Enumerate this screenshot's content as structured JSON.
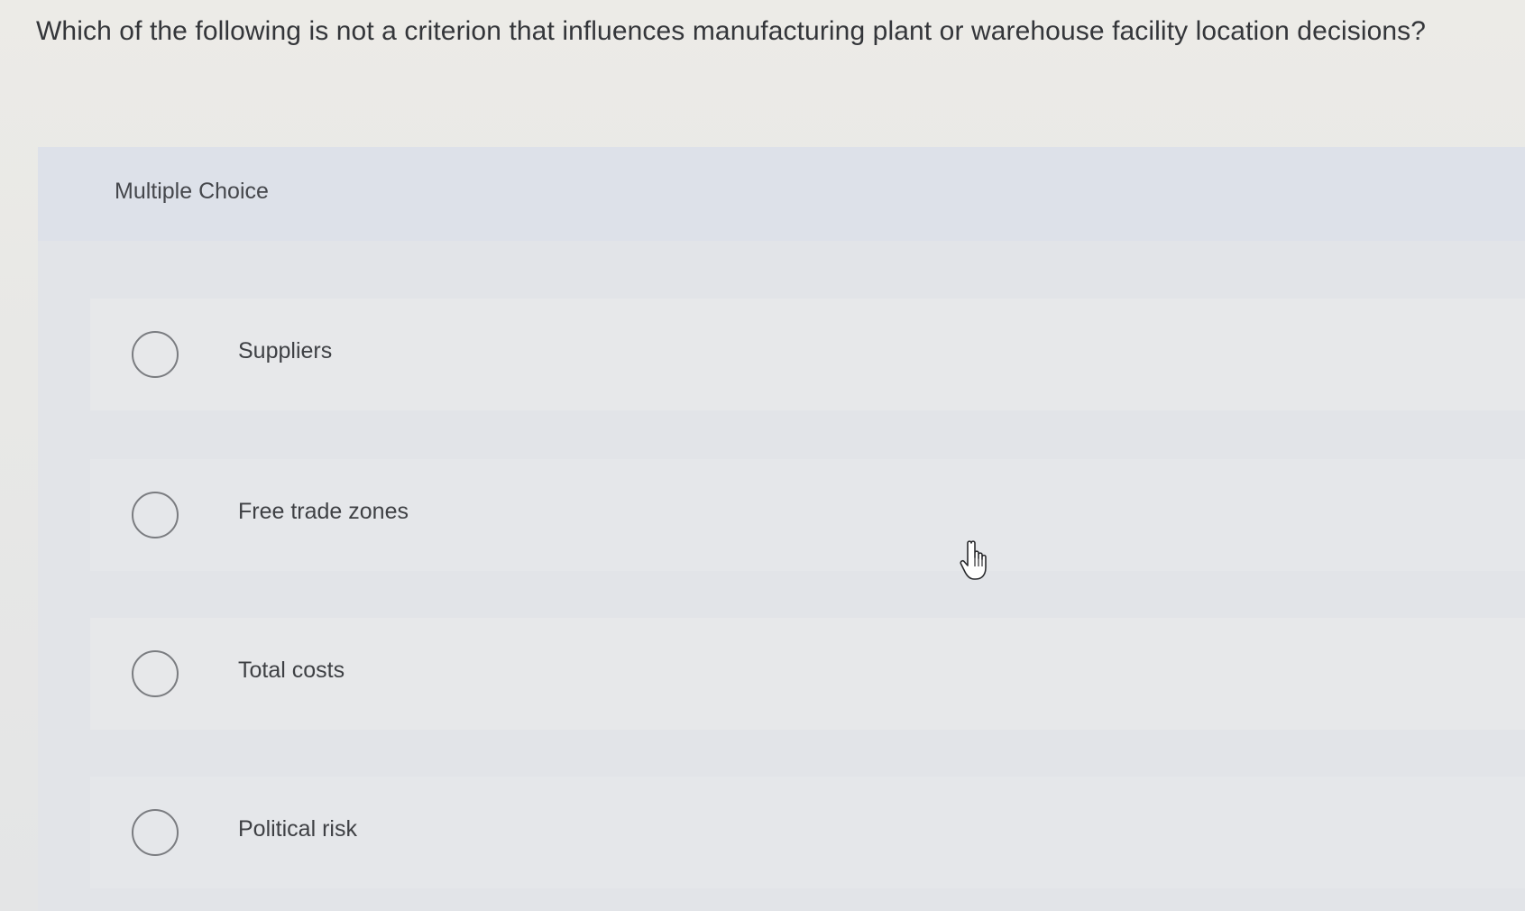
{
  "question": {
    "text": "Which of the following is not a criterion that influences manufacturing plant or warehouse facility location decisions?"
  },
  "panel": {
    "title": "Multiple Choice"
  },
  "choices": [
    {
      "label": "Suppliers",
      "selected": false
    },
    {
      "label": "Free trade zones",
      "selected": false
    },
    {
      "label": "Total costs",
      "selected": false
    },
    {
      "label": "Political risk",
      "selected": false
    }
  ],
  "cursor": {
    "icon": "hand-pointer-icon"
  }
}
